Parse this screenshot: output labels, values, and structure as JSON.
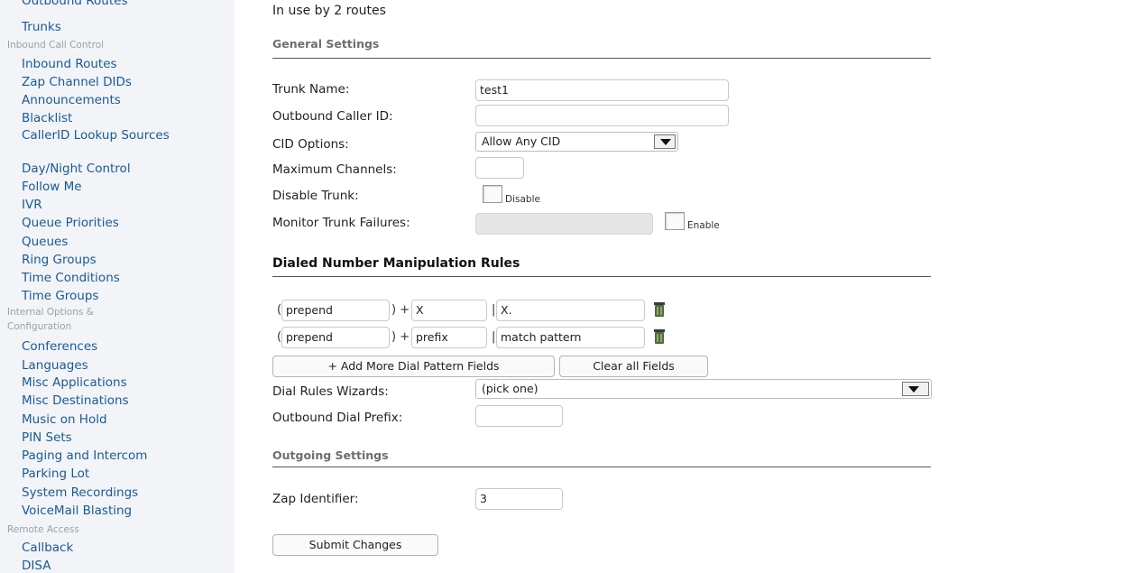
{
  "sidebar": {
    "top_partial": "Outbound Routes",
    "items_a": [
      "Trunks"
    ],
    "section_inbound": "Inbound Call Control",
    "items_b": [
      "Inbound Routes",
      "Zap Channel DIDs",
      "Announcements",
      "Blacklist"
    ],
    "callerid_lookup": "CallerID Lookup Sources",
    "items_c": [
      "Day/Night Control",
      "Follow Me",
      "IVR",
      "Queue Priorities",
      "Queues",
      "Ring Groups",
      "Time Conditions",
      "Time Groups"
    ],
    "section_internal": "Internal Options & Configuration",
    "items_d": [
      "Conferences",
      "Languages",
      "Misc Applications",
      "Misc Destinations",
      "Music on Hold",
      "PIN Sets",
      "Paging and Intercom",
      "Parking Lot",
      "System Recordings",
      "VoiceMail Blasting"
    ],
    "section_remote": "Remote Access",
    "items_e": [
      "Callback",
      "DISA"
    ]
  },
  "main": {
    "in_use": "In use by 2 routes",
    "general_settings": "General Settings",
    "trunk_name_label": "Trunk Name:",
    "trunk_name_value": "test1",
    "outbound_cid_label": "Outbound Caller ID:",
    "outbound_cid_value": "",
    "cid_options_label": "CID Options:",
    "cid_options_value": "Allow Any CID",
    "max_channels_label": "Maximum Channels:",
    "max_channels_value": "",
    "disable_trunk_label": "Disable Trunk:",
    "disable_label": "Disable",
    "monitor_label": "Monitor Trunk Failures:",
    "enable_label": "Enable",
    "dial_rules_header": "Dialed Number Manipulation Rules",
    "rules": [
      {
        "prepend": "prepend",
        "prefix": "X",
        "pattern": "X."
      },
      {
        "prepend": "prepend",
        "prefix": "prefix",
        "pattern": "match pattern"
      }
    ],
    "paren_open": "(",
    "paren_close_plus": ") +",
    "pipe": "|",
    "add_more_button": "+ Add More Dial Pattern Fields",
    "clear_all_button": "Clear all Fields",
    "wizards_label": "Dial Rules Wizards:",
    "wizards_value": "(pick one)",
    "outbound_prefix_label": "Outbound Dial Prefix:",
    "outbound_prefix_value": "",
    "outgoing_settings": "Outgoing Settings",
    "zap_identifier_label": "Zap Identifier:",
    "zap_identifier_value": "3",
    "submit_button": "Submit Changes"
  },
  "colors": {
    "link": "#1a5a95",
    "section": "#9aa2aa",
    "sidebar_bg": "#f2f4f7"
  }
}
